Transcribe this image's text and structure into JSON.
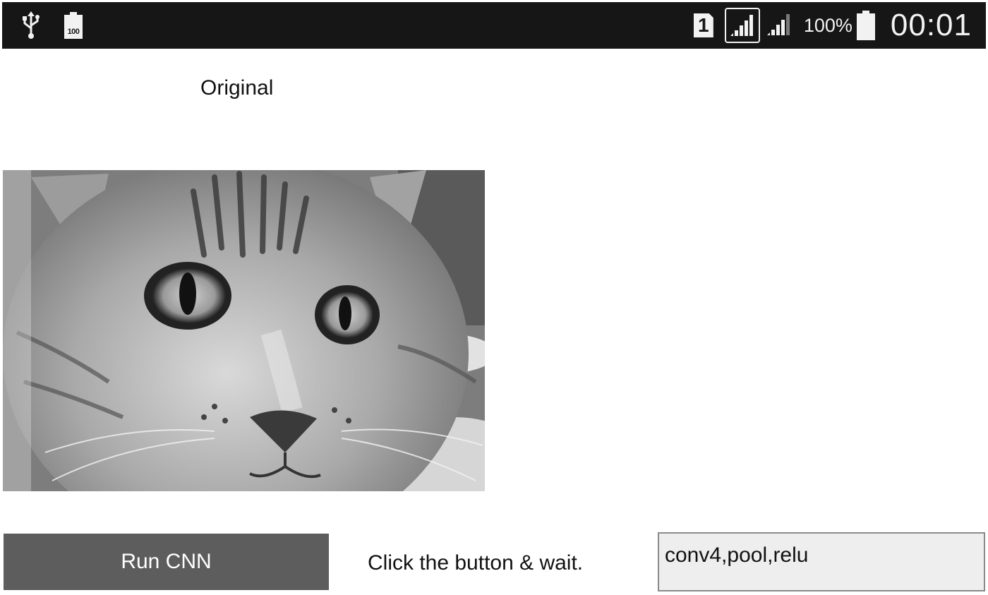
{
  "status_bar": {
    "left_icons": [
      "usb-icon",
      "battery-icon"
    ],
    "battery_icon_label": "100",
    "sim_slot": "1",
    "signal_icons": [
      "signal-strength-icon",
      "signal-strength-icon"
    ],
    "battery_percent": "100%",
    "time": "00:01"
  },
  "main": {
    "image_title": "Original",
    "image_subject": "cat",
    "run_button_label": "Run CNN",
    "status_message": "Click the button & wait.",
    "output_value": "conv4,pool,relu"
  },
  "colors": {
    "status_bar_bg": "#161616",
    "button_bg": "#5d5d5d",
    "output_field_bg": "#eeeeee"
  }
}
